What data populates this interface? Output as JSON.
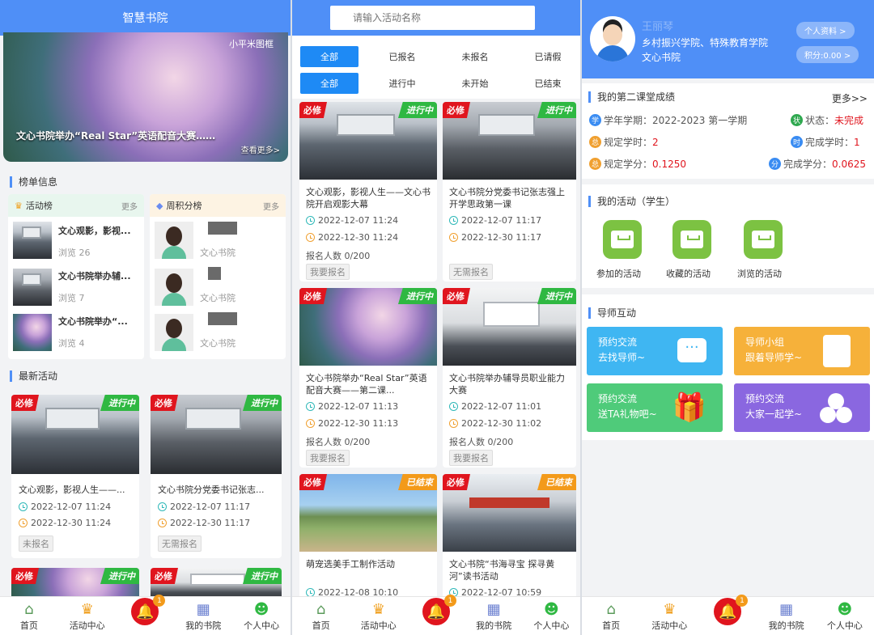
{
  "home": {
    "title": "智慧书院",
    "banner_caption": "文心书院举办“Real Star”英语配音大赛……",
    "banner_more": "查看更多>",
    "banner_logo": "小平米图框",
    "rank_section": "榜单信息",
    "rank_left": {
      "title": "活动榜",
      "more": "更多",
      "items": [
        {
          "title": "文心观影，影视...",
          "views": "浏览 26"
        },
        {
          "title": "文心书院举办辅...",
          "views": "浏览 7"
        },
        {
          "title": "文心书院举办“...",
          "views": "浏览 4"
        }
      ]
    },
    "rank_right": {
      "title": "周积分榜",
      "more": "更多",
      "items": [
        {
          "org": "文心书院"
        },
        {
          "org": "文心书院"
        },
        {
          "org": "文心书院"
        }
      ]
    },
    "latest_section": "最新活动",
    "cards": [
      {
        "req": "必修",
        "status": "进行中",
        "title": "文心观影，影视人生——...",
        "start": "2022-12-07 11:24",
        "end": "2022-12-30 11:24",
        "chip": "未报名"
      },
      {
        "req": "必修",
        "status": "进行中",
        "title": "文心书院分党委书记张志...",
        "start": "2022-12-07 11:17",
        "end": "2022-12-30 11:17",
        "chip": "无需报名"
      }
    ],
    "bottom_cards": [
      {
        "req": "必修",
        "status": "进行中"
      },
      {
        "req": "必修",
        "status": "进行中"
      }
    ]
  },
  "activity": {
    "search_placeholder": "请输入活动名称",
    "filters_row1": [
      "全部",
      "已报名",
      "未报名",
      "已请假"
    ],
    "filters_row2": [
      "全部",
      "进行中",
      "未开始",
      "已结束"
    ],
    "cards": [
      {
        "req": "必修",
        "status": "进行中",
        "title": "文心观影，影视人生——文心书院开启观影大幕",
        "start": "2022-12-07 11:24",
        "end": "2022-12-30 11:24",
        "count": "报名人数  0/200",
        "chip": "我要报名"
      },
      {
        "req": "必修",
        "status": "进行中",
        "title": "文心书院分党委书记张志强上开学思政第一课",
        "start": "2022-12-07 11:17",
        "end": "2022-12-30 11:17",
        "count": "",
        "chip": "无需报名"
      },
      {
        "req": "必修",
        "status": "进行中",
        "title": "文心书院举办“Real Star”英语配音大赛——第二课...",
        "start": "2022-12-07 11:13",
        "end": "2022-12-30 11:13",
        "count": "报名人数  0/200",
        "chip": "我要报名"
      },
      {
        "req": "必修",
        "status": "进行中",
        "title": "文心书院举办辅导员职业能力大赛",
        "start": "2022-12-07 11:01",
        "end": "2022-12-30 11:02",
        "count": "报名人数  0/200",
        "chip": "我要报名"
      },
      {
        "req": "必修",
        "status": "已结束",
        "title": "萌宠选美手工制作活动",
        "start": "2022-12-08 10:10",
        "end": "",
        "count": "",
        "chip": ""
      },
      {
        "req": "必修",
        "status": "已结束",
        "title": "文心书院“书海寻宝 探寻黄河”读书活动",
        "start": "2022-12-07 10:59",
        "end": "",
        "count": "",
        "chip": ""
      }
    ]
  },
  "profile": {
    "name": "王丽琴",
    "college": "乡村振兴学院、特殊教育学院",
    "academy": "文心书院",
    "btn_profile": "个人资料 >",
    "btn_points": "积分:0.00 >",
    "score_section": "我的第二课堂成绩",
    "score_more": "更多>>",
    "term_label": "学年学期：",
    "term_value": "2022-2023 第一学期",
    "status_label": "状态：",
    "status_value": "未完成",
    "req_hours_label": "规定学时：",
    "req_hours_value": "2",
    "done_hours_label": "完成学时：",
    "done_hours_value": "1",
    "req_credit_label": "规定学分：",
    "req_credit_value": "0.1250",
    "done_credit_label": "完成学分：",
    "done_credit_value": "0.0625",
    "icons": {
      "term": "学",
      "status": "状",
      "req": "总",
      "done": "时",
      "credit": "总",
      "done_credit": "分"
    },
    "my_act_section": "我的活动（学生）",
    "my_acts": [
      "参加的活动",
      "收藏的活动",
      "浏览的活动"
    ],
    "mentor_section": "导师互动",
    "mentor_tiles": [
      {
        "l1": "预约交流",
        "l2": "去找导师~",
        "color": "#3fb6f2"
      },
      {
        "l1": "导师小组",
        "l2": "跟着导师学~",
        "color": "#f6b13a"
      },
      {
        "l1": "预约交流",
        "l2": "送TA礼物吧~",
        "color": "#4fcb7a"
      },
      {
        "l1": "预约交流",
        "l2": "大家一起学~",
        "color": "#8a67e0"
      }
    ]
  },
  "tabbar": {
    "items": [
      "首页",
      "活动中心",
      "",
      "我的书院",
      "个人中心"
    ],
    "badge": "1"
  },
  "colors": {
    "primary": "#4f8ff7",
    "red": "#e0151e",
    "green": "#2fb842",
    "orange": "#f39a1a"
  }
}
